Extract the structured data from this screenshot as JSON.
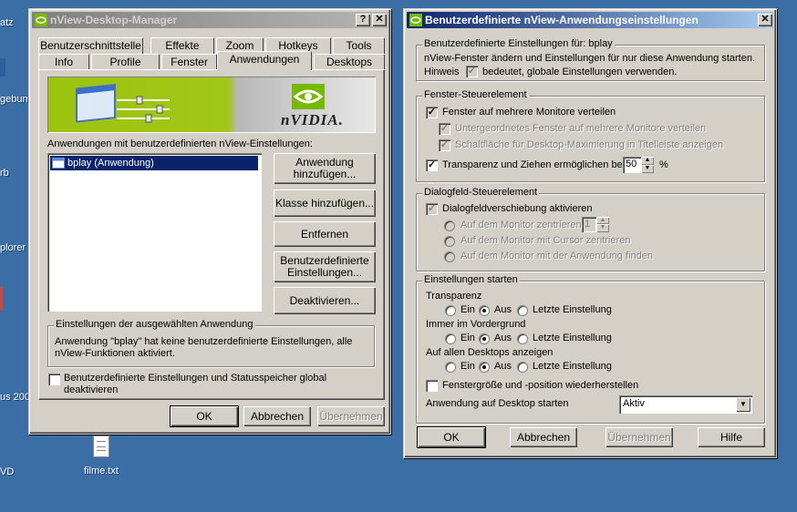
{
  "desktop": {
    "fragments": [
      "atz",
      "gebung",
      "rb",
      "plorer",
      "us 200",
      "VD"
    ],
    "file_label": "filme.txt"
  },
  "left_window": {
    "title": "nView-Desktop-Manager",
    "help_btn": "?",
    "close_btn": "✕",
    "tabs_row1": [
      "Benutzerschnittstelle",
      "Effekte",
      "Zoom",
      "Hotkeys",
      "Tools"
    ],
    "tabs_row2": [
      "Info",
      "Profile",
      "Fenster",
      "Anwendungen",
      "Desktops"
    ],
    "banner_brand": "nVIDIA.",
    "list_label": "Anwendungen mit benutzerdefinierten nView-Einstellungen:",
    "list_items": [
      "bplay (Anwendung)"
    ],
    "buttons": {
      "add_app": "Anwendung hinzufügen...",
      "add_class": "Klasse hinzufügen...",
      "remove": "Entfernen",
      "custom": "Benutzerdefinierte Einstellungen...",
      "deactivate": "Deaktivieren..."
    },
    "selected_group_title": "Einstellungen der ausgewählten Anwendung",
    "selected_group_text": "Anwendung \"bplay\" hat keine benutzerdefinierte Einstellungen, alle nView-Funktionen aktiviert.",
    "global_checkbox": "Benutzerdefinierte Einstellungen und Statusspeicher global deaktivieren",
    "ok": "OK",
    "cancel": "Abbrechen",
    "apply": "Übernehmen"
  },
  "right_window": {
    "title": "Benutzerdefinierte nView-Anwendungseinstellungen",
    "close_btn": "✕",
    "g1_title": "Benutzerdefinierte Einstellungen für: bplay",
    "g1_line": "nView-Fenster ändern und Einstellungen für nur diese Anwendung starten.",
    "g1_hint_a": "Hinweis",
    "g1_hint_b": "bedeutet, globale Einstellungen verwenden.",
    "g2_title": "Fenster-Steuerelement",
    "g2_cb1": "Fenster auf mehrere Monitore verteilen",
    "g2_cb2": "Untergeordnetes Fenster auf mehrere Monitore verteilen",
    "g2_cb3": "Schaltfläche für Desktop-Maximierung in Titelleiste anzeigen",
    "g2_cb4": "Transparenz und Ziehen ermöglichen bei",
    "g2_value": "50",
    "g2_unit": "%",
    "g3_title": "Dialogfeld-Steuerelement",
    "g3_cb": "Dialogfeldverschiebung aktivieren",
    "g3_r1": "Auf dem Monitor zentrieren",
    "g3_r1_value": "1",
    "g3_r2": "Auf dem Monitor mit Cursor zentrieren",
    "g3_r3": "Auf dem Monitor mit der Anwendung finden",
    "g4_title": "Einstellungen starten",
    "g4_sections": [
      {
        "label": "Transparenz",
        "on": "Ein",
        "off": "Aus",
        "last": "Letzte Einstellung"
      },
      {
        "label": "Immer im Vordergrund",
        "on": "Ein",
        "off": "Aus",
        "last": "Letzte Einstellung"
      },
      {
        "label": "Auf allen Desktops anzeigen",
        "on": "Ein",
        "off": "Aus",
        "last": "Letzte Einstellung"
      }
    ],
    "g4_cb": "Fenstergröße und -position wiederherstellen",
    "g4_select_label": "Anwendung auf Desktop starten",
    "g4_select_value": "Aktiv",
    "ok": "OK",
    "cancel": "Abbrechen",
    "apply": "Übernehmen",
    "help": "Hilfe"
  }
}
